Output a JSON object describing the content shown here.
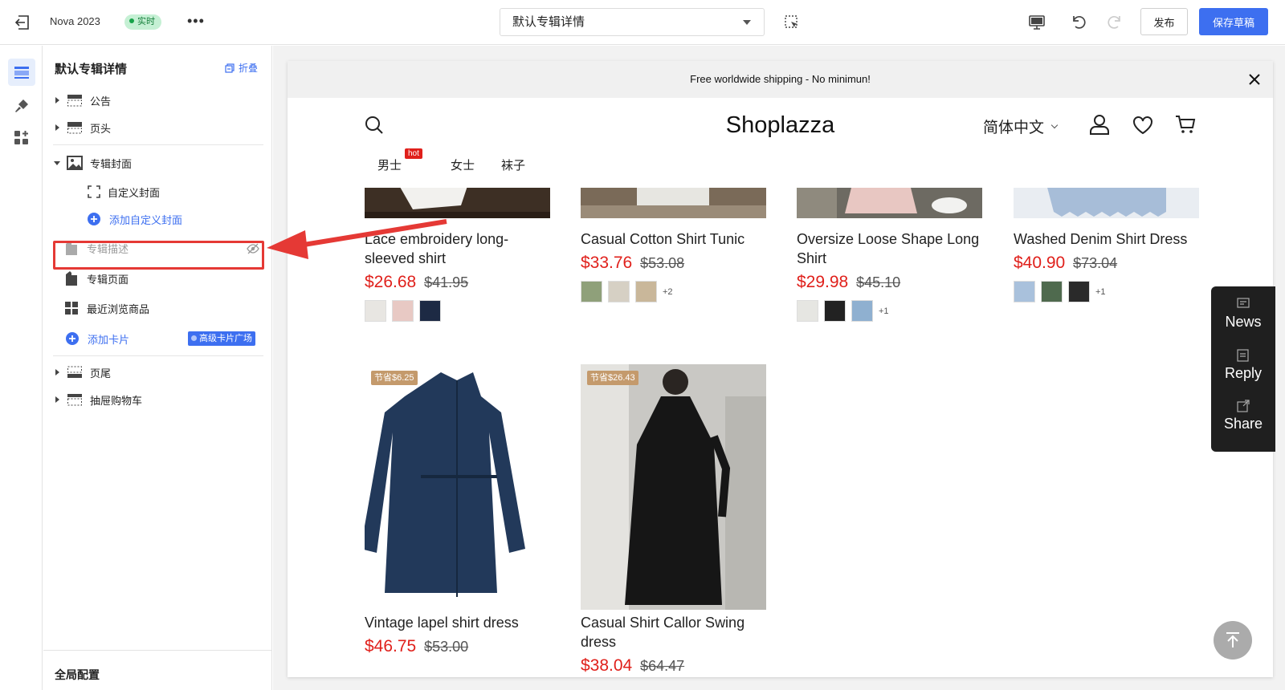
{
  "topbar": {
    "app_name": "Nova 2023",
    "status_badge": "实时",
    "more": "•••",
    "page_select": "默认专辑详情",
    "publish_label": "发布",
    "save_draft_label": "保存草稿"
  },
  "icons": {
    "exit": "exit-icon",
    "selection": "selection-icon",
    "desktop": "desktop-icon",
    "undo": "undo-icon",
    "redo": "redo-icon"
  },
  "panel": {
    "title": "默认专辑详情",
    "collapse_label": "折叠",
    "sections": {
      "announcement": "公告",
      "header": "页头",
      "album_cover": "专辑封面",
      "custom_cover": "自定义封面",
      "add_custom_cover": "添加自定义封面",
      "album_description": "专辑描述",
      "album_page": "专辑页面",
      "recently_viewed": "最近浏览商品",
      "add_card": "添加卡片",
      "advanced_card_plaza": "高级卡片广场",
      "footer": "页尾",
      "drawer_cart": "抽屉购物车"
    },
    "footer_label": "全局配置"
  },
  "store": {
    "announcement": "Free worldwide shipping - No minimun!",
    "logo": "Shoplazza",
    "language": "简体中文",
    "nav": [
      "男士",
      "女士",
      "袜子"
    ],
    "hot_badge": "hot"
  },
  "products": [
    {
      "title": "Lace embroidery long-sleeved shirt",
      "price": "$26.68",
      "compare": "$41.95",
      "swatches": [
        "#e8e6e2",
        "#e8c9c4",
        "#1d2a44"
      ],
      "more": ""
    },
    {
      "title": "Casual Cotton Shirt Tunic",
      "price": "$33.76",
      "compare": "$53.08",
      "swatches": [
        "#8fa07a",
        "#d6d0c4",
        "#c9b79a"
      ],
      "more": "+2"
    },
    {
      "title": "Oversize Loose Shape Long Shirt",
      "price": "$29.98",
      "compare": "$45.10",
      "swatches": [
        "#e6e6e2",
        "#222222",
        "#8fb0d0"
      ],
      "more": "+1"
    },
    {
      "title": "Washed Denim Shirt Dress",
      "price": "$40.90",
      "compare": "$73.04",
      "swatches": [
        "#a9c1dc",
        "#4f6a4e",
        "#2a2a2a"
      ],
      "more": "+1"
    },
    {
      "title": "Vintage lapel shirt dress",
      "price": "$46.75",
      "compare": "$53.00",
      "save_tag": "节省$6.25"
    },
    {
      "title": "Casual Shirt Callor Swing dress",
      "price": "$38.04",
      "compare": "$64.47",
      "save_tag": "节省$26.43"
    }
  ],
  "floating_menu": {
    "news": "News",
    "reply": "Reply",
    "share": "Share"
  },
  "colors": {
    "accent": "#3d6ff0",
    "price_red": "#e0201b",
    "highlight_red": "#e53935",
    "live_green": "#17a34a"
  }
}
